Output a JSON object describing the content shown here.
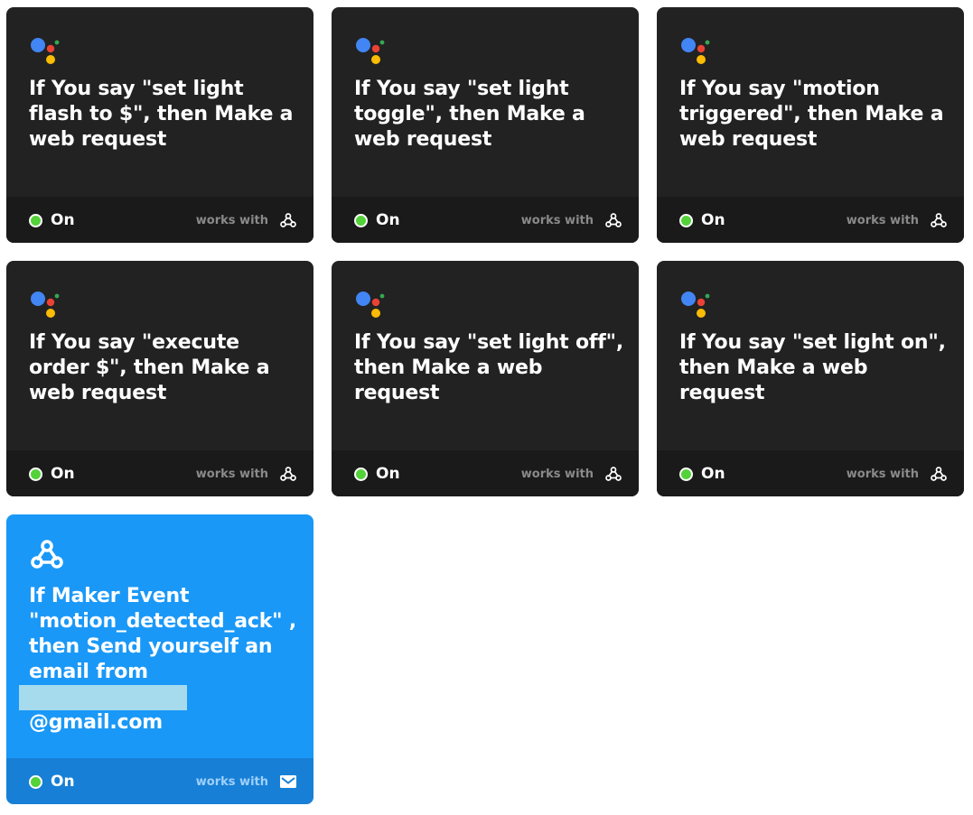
{
  "applets": [
    {
      "title": "If You say \"set light flash to $\", then Make a web request",
      "status": "On",
      "works_with": "works with",
      "service_icon": "google-assistant-icon",
      "works_icon": "webhooks-icon"
    },
    {
      "title": "If You say \"set light toggle\", then Make a web request",
      "status": "On",
      "works_with": "works with",
      "service_icon": "google-assistant-icon",
      "works_icon": "webhooks-icon"
    },
    {
      "title": "If You say \"motion triggered\", then Make a web request",
      "status": "On",
      "works_with": "works with",
      "service_icon": "google-assistant-icon",
      "works_icon": "webhooks-icon"
    },
    {
      "title": "If You say \"execute order $\", then Make a web request",
      "status": "On",
      "works_with": "works with",
      "service_icon": "google-assistant-icon",
      "works_icon": "webhooks-icon"
    },
    {
      "title": "If You say \"set light off\", then Make a web request",
      "status": "On",
      "works_with": "works with",
      "service_icon": "google-assistant-icon",
      "works_icon": "webhooks-icon"
    },
    {
      "title": "If You say \"set light on\", then Make a web request",
      "status": "On",
      "works_with": "works with",
      "service_icon": "google-assistant-icon",
      "works_icon": "webhooks-icon"
    },
    {
      "title_prefix": "If Maker Event \"motion_detected_ack\" , then Send yourself an email from",
      "title_suffix": "@gmail.com",
      "status": "On",
      "works_with": "works with",
      "service_icon": "webhooks-icon",
      "works_icon": "email-icon"
    }
  ],
  "colors": {
    "dark_card": "#222222",
    "blue_card": "#1a98f7",
    "status_on": "#54d23a"
  }
}
